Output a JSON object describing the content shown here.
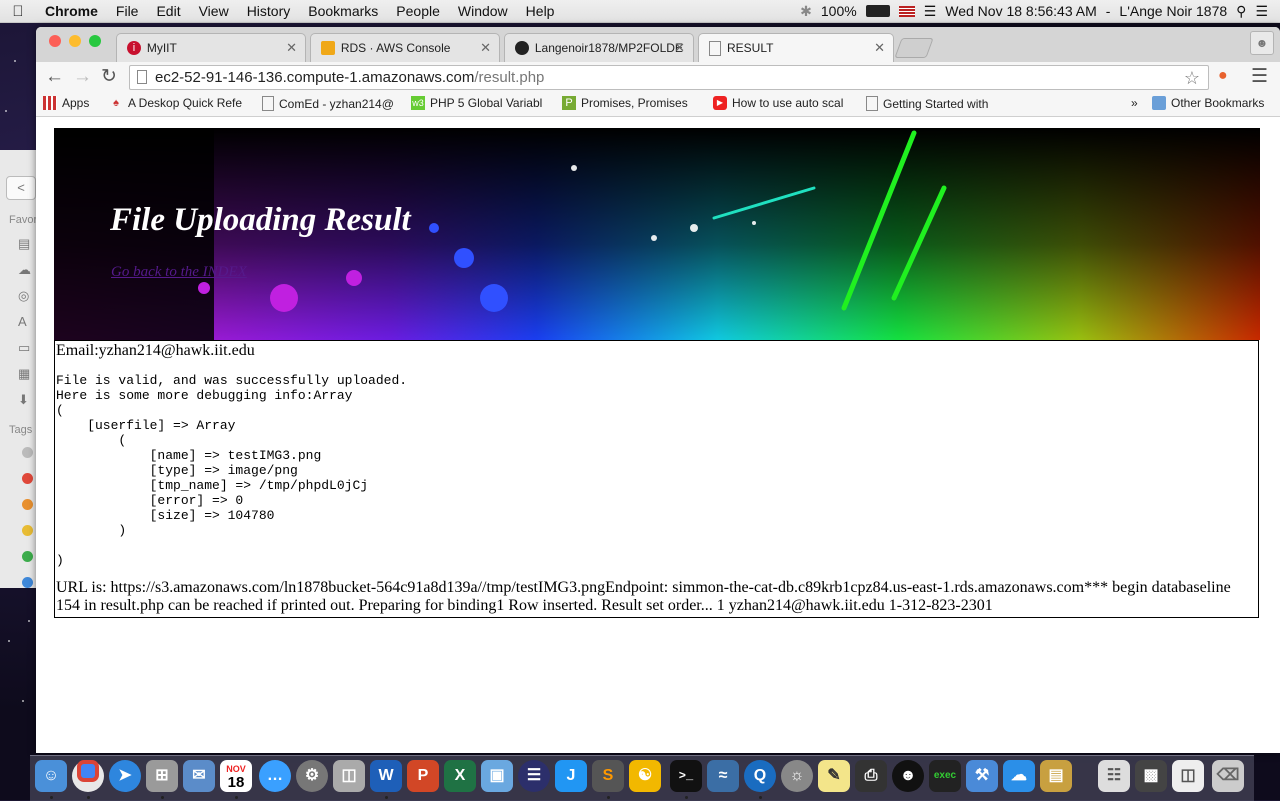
{
  "menubar": {
    "app_name": "Chrome",
    "items": [
      "File",
      "Edit",
      "View",
      "History",
      "Bookmarks",
      "People",
      "Window",
      "Help"
    ],
    "battery": "100%",
    "datetime": "Wed Nov 18  8:56:43 AM",
    "user": "L'Ange Noir 1878"
  },
  "finder": {
    "favorites_label": "Favor",
    "tags_label": "Tags",
    "tag_colors": [
      "#bbbbbb",
      "#e0483a",
      "#e8902f",
      "#e8bc34",
      "#3dad4c",
      "#3f88d9"
    ]
  },
  "tabs": [
    {
      "label": "MyIIT",
      "icon": "iit-icon",
      "active": false
    },
    {
      "label": "RDS · AWS Console",
      "icon": "aws-icon",
      "active": false
    },
    {
      "label": "Langenoir1878/MP2FOLDE",
      "icon": "github-icon",
      "active": false
    },
    {
      "label": "RESULT",
      "icon": "page-icon",
      "active": true
    }
  ],
  "address_bar": {
    "host": "ec2-52-91-146-136.compute-1.amazonaws.com",
    "path": "/result.php"
  },
  "bookmarks": [
    {
      "label": "Apps",
      "icon": "apps-icon"
    },
    {
      "label": "A Deskop Quick Refe",
      "icon": "bookmark-icon"
    },
    {
      "label": "ComEd - yzhan214@",
      "icon": "page-icon"
    },
    {
      "label": "PHP 5 Global Variabl",
      "icon": "w3-icon"
    },
    {
      "label": "Promises, Promises",
      "icon": "bookmark-icon"
    },
    {
      "label": "How to use auto scal",
      "icon": "youtube-icon"
    },
    {
      "label": "Getting Started with",
      "icon": "page-icon"
    }
  ],
  "bookmarks_overflow": "»",
  "other_bookmarks": "Other Bookmarks",
  "page": {
    "heading": "File Uploading Result",
    "back_link": "Go back to the INDEX",
    "email_line": "Email:yzhan214@hawk.iit.edu",
    "debug_output": "File is valid, and was successfully uploaded.\nHere is some more debugging info:Array\n(\n    [userfile] => Array\n        (\n            [name] => testIMG3.png\n            [type] => image/png\n            [tmp_name] => /tmp/phpdL0jCj\n            [error] => 0\n            [size] => 104780\n        )\n\n)",
    "url_line": "URL is: https://s3.amazonaws.com/ln1878bucket-564c91a8d139a//tmp/testIMG3.pngEndpoint: simmon-the-cat-db.c89krb1cpz84.us-east-1.rds.amazonaws.com*** begin databaseline 154 in result.php can be reached if printed out. Preparing for binding1 Row inserted. Result set order... 1 yzhan214@hawk.iit.edu 1-312-823-2301"
  },
  "dock_calendar": {
    "month": "NOV",
    "day": "18"
  }
}
